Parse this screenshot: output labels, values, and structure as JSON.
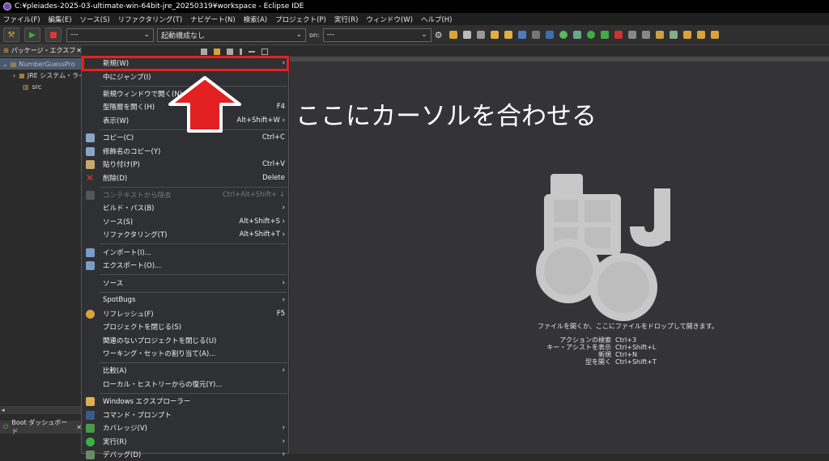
{
  "window": {
    "title": "C:¥pleiades-2025-03-ultimate-win-64bit-jre_20250319¥workspace - Eclipse IDE"
  },
  "menubar": [
    "ファイル(F)",
    "編集(E)",
    "ソース(S)",
    "リファクタリング(T)",
    "ナビゲート(N)",
    "検索(A)",
    "プロジェクト(P)",
    "実行(R)",
    "ウィンドウ(W)",
    "ヘルプ(H)"
  ],
  "toolbar": {
    "mode_value": "---",
    "launch_config": "起動構成なし",
    "on_label": "on:",
    "on_value": "---"
  },
  "package_explorer": {
    "title": "パッケージ・エクスプローラー",
    "project": "NumberGuessPro",
    "jre": "JRE システム・ライ",
    "src": "src"
  },
  "boot_dashboard": {
    "title": "Boot ダッシュボード"
  },
  "context_menu": [
    {
      "label": "新規(W)",
      "accel": "›"
    },
    {
      "label": "中にジャンプ(I)",
      "accel": ""
    },
    {
      "label": "新規ウィンドウで開く(N)",
      "accel": ""
    },
    {
      "label": "型階層を開く(H)",
      "accel": "F4"
    },
    {
      "label": "表示(W)",
      "accel": "Alt+Shift+W ›"
    },
    {
      "label": "コピー(C)",
      "accel": "Ctrl+C"
    },
    {
      "label": "修飾名のコピー(Y)",
      "accel": ""
    },
    {
      "label": "貼り付け(P)",
      "accel": "Ctrl+V"
    },
    {
      "label": "削除(D)",
      "accel": "Delete"
    },
    {
      "label": "コンテキストから除去",
      "accel": "Ctrl+Alt+Shift+ ↓"
    },
    {
      "label": "ビルド・パス(B)",
      "accel": "›"
    },
    {
      "label": "ソース(S)",
      "accel": "Alt+Shift+S ›"
    },
    {
      "label": "リファクタリング(T)",
      "accel": "Alt+Shift+T ›"
    },
    {
      "label": "インポート(I)...",
      "accel": ""
    },
    {
      "label": "エクスポート(O)...",
      "accel": ""
    },
    {
      "label": "ソース",
      "accel": "›"
    },
    {
      "label": "SpotBugs",
      "accel": "›"
    },
    {
      "label": "リフレッシュ(F)",
      "accel": "F5"
    },
    {
      "label": "プロジェクトを閉じる(S)",
      "accel": ""
    },
    {
      "label": "関連のないプロジェクトを閉じる(U)",
      "accel": ""
    },
    {
      "label": "ワーキング・セットの割り当て(A)...",
      "accel": ""
    },
    {
      "label": "比較(A)",
      "accel": "›"
    },
    {
      "label": "ローカル・ヒストリーからの復元(Y)...",
      "accel": ""
    },
    {
      "label": "Windows エクスプローラー",
      "accel": ""
    },
    {
      "label": "コマンド・プロンプト",
      "accel": ""
    },
    {
      "label": "カバレッジ(V)",
      "accel": "›"
    },
    {
      "label": "実行(R)",
      "accel": "›"
    },
    {
      "label": "デバッグ(D)",
      "accel": "›"
    }
  ],
  "annotation": "ここにカーソルを合わせる",
  "editor": {
    "hint": "ファイルを開くか、ここにファイルをドロップして開きます。",
    "shortcuts": [
      {
        "label": "アクションの検索",
        "key": "Ctrl+3"
      },
      {
        "label": "キー・アシストを表示",
        "key": "Ctrl+Shift+L"
      },
      {
        "label": "新規",
        "key": "Ctrl+N"
      },
      {
        "label": "型を開く",
        "key": "Ctrl+Shift+T"
      }
    ]
  },
  "colors": {
    "highlight": "#e32121"
  }
}
